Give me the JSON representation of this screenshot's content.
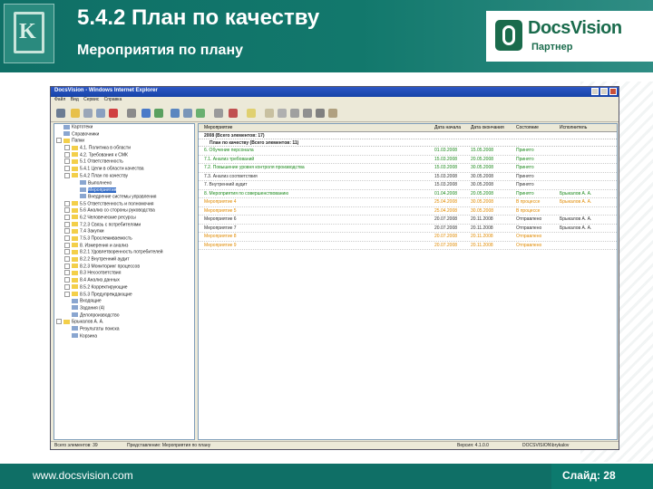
{
  "slide": {
    "title": "5.4.2 План по качеству",
    "subtitle": "Мероприятия по плану",
    "footer_url": "www.docsvision.com",
    "slide_number": "Слайд: 28"
  },
  "brand": {
    "name": "DocsVision",
    "partner": "Партнер",
    "colors": {
      "header": "#0f6f66",
      "logo_green": "#1a6b4c",
      "link_green": "#1d8a1d",
      "orange": "#e08a00"
    }
  },
  "window": {
    "title": "DocsVision - Windows Internet Explorer",
    "menu": [
      "Файл",
      "Вид",
      "Сервис",
      "Справка"
    ],
    "tree": [
      {
        "label": "Картотеки",
        "depth": 0,
        "type": "leaf",
        "icon": "doc"
      },
      {
        "label": "Справочники",
        "depth": 0,
        "type": "leaf",
        "icon": "doc"
      },
      {
        "label": "Папки",
        "depth": 0,
        "type": "collapse",
        "icon": "folder"
      },
      {
        "label": "4.1. Политика в области",
        "depth": 1,
        "type": "expand",
        "icon": "folder"
      },
      {
        "label": "4.2. Требования к СМК",
        "depth": 1,
        "type": "expand",
        "icon": "folder"
      },
      {
        "label": "5.1 Ответственность",
        "depth": 1,
        "type": "expand",
        "icon": "folder"
      },
      {
        "label": "5.4.1 Цели в области качества",
        "depth": 1,
        "type": "expand",
        "icon": "folder"
      },
      {
        "label": "5.4.2 План по качеству",
        "depth": 1,
        "type": "collapse",
        "icon": "folder"
      },
      {
        "label": "Выполнено",
        "depth": 2,
        "type": "leaf",
        "icon": "doc"
      },
      {
        "label": "Мероприятия",
        "depth": 2,
        "type": "leaf",
        "icon": "doc",
        "selected": true
      },
      {
        "label": "Внедрение системы управления",
        "depth": 2,
        "type": "leaf",
        "icon": "doc"
      },
      {
        "label": "5.5 Ответственность и полномочия",
        "depth": 1,
        "type": "expand",
        "icon": "folder"
      },
      {
        "label": "5.6 Анализ со стороны руководства",
        "depth": 1,
        "type": "expand",
        "icon": "folder"
      },
      {
        "label": "6.2 Человеческие ресурсы",
        "depth": 1,
        "type": "expand",
        "icon": "folder"
      },
      {
        "label": "7.2.3 Связь с потребителями",
        "depth": 1,
        "type": "expand",
        "icon": "folder"
      },
      {
        "label": "7.4 Закупки",
        "depth": 1,
        "type": "expand",
        "icon": "folder"
      },
      {
        "label": "7.5.3 Прослеживаемость",
        "depth": 1,
        "type": "expand",
        "icon": "folder"
      },
      {
        "label": "8. Измерения и анализ",
        "depth": 1,
        "type": "expand",
        "icon": "folder"
      },
      {
        "label": "8.2.1 Удовлетворенность потребителей",
        "depth": 1,
        "type": "expand",
        "icon": "folder"
      },
      {
        "label": "8.2.2 Внутренний аудит",
        "depth": 1,
        "type": "expand",
        "icon": "folder"
      },
      {
        "label": "8.2.3 Мониторинг процессов",
        "depth": 1,
        "type": "expand",
        "icon": "folder"
      },
      {
        "label": "8.3 Несоответствия",
        "depth": 1,
        "type": "expand",
        "icon": "folder"
      },
      {
        "label": "8.4 Анализ данных",
        "depth": 1,
        "type": "expand",
        "icon": "folder"
      },
      {
        "label": "8.5.2 Корректирующие",
        "depth": 1,
        "type": "expand",
        "icon": "folder"
      },
      {
        "label": "8.5.3 Предупреждающие",
        "depth": 1,
        "type": "expand",
        "icon": "folder"
      },
      {
        "label": "Входящие",
        "depth": 1,
        "type": "leaf",
        "icon": "doc"
      },
      {
        "label": "Задания (4)",
        "depth": 1,
        "type": "leaf",
        "icon": "doc"
      },
      {
        "label": "Делопроизводство",
        "depth": 1,
        "type": "leaf",
        "icon": "doc"
      },
      {
        "label": "Брыкалов А. А.",
        "depth": 0,
        "type": "collapse",
        "icon": "folder"
      },
      {
        "label": "Результаты поиска",
        "depth": 1,
        "type": "leaf",
        "icon": "doc"
      },
      {
        "label": "Корзина",
        "depth": 1,
        "type": "leaf",
        "icon": "doc"
      }
    ],
    "columns": [
      "Мероприятие",
      "Дата начала",
      "Дата окончания",
      "Состояние",
      "Исполнитель"
    ],
    "group1": "2008 (Всего элементов: 17)",
    "group2": "План по качеству (Всего элементов: 11)",
    "rows": [
      {
        "name": "6. Обучение персонала",
        "start": "01.03.2008",
        "end": "15.05.2008",
        "status": "Принято",
        "owner": "",
        "color": "green"
      },
      {
        "name": "7.1. Анализ требований",
        "start": "15.03.2008",
        "end": "20.05.2008",
        "status": "Принято",
        "owner": "",
        "color": "green"
      },
      {
        "name": "7.2. Повышение уровня контроля производства",
        "start": "15.03.2008",
        "end": "30.05.2008",
        "status": "Принято",
        "owner": "",
        "color": "green"
      },
      {
        "name": "7.3. Анализ соответствия",
        "start": "15.03.2008",
        "end": "30.05.2008",
        "status": "Принято",
        "owner": "",
        "color": "dark"
      },
      {
        "name": "7. Внутренний аудит",
        "start": "15.03.2008",
        "end": "30.05.2008",
        "status": "Принято",
        "owner": "",
        "color": "dark"
      },
      {
        "name": "8. Мероприятия по совершенствованию",
        "start": "01.04.2008",
        "end": "20.05.2008",
        "status": "Принято",
        "owner": "Брыкалов А. А.",
        "color": "green"
      },
      {
        "name": "Мероприятие 4",
        "start": "25.04.2008",
        "end": "30.05.2008",
        "status": "В процессе",
        "owner": "Брыкалов А. А.",
        "color": "orange"
      },
      {
        "name": "Мероприятие 5",
        "start": "25.04.2008",
        "end": "30.05.2008",
        "status": "В процессе",
        "owner": "",
        "color": "orange"
      },
      {
        "name": "Мероприятие 6",
        "start": "20.07.2008",
        "end": "20.11.2008",
        "status": "Отправлено",
        "owner": "Брыкалов А. А.",
        "color": "dark"
      },
      {
        "name": "Мероприятие 7",
        "start": "20.07.2008",
        "end": "20.11.2008",
        "status": "Отправлено",
        "owner": "Брыкалов А. А.",
        "color": "dark"
      },
      {
        "name": "Мероприятие 8",
        "start": "20.07.2008",
        "end": "20.11.2008",
        "status": "Отправлено",
        "owner": "",
        "color": "orange"
      },
      {
        "name": "Мероприятие 9",
        "start": "20.07.2008",
        "end": "20.11.2008",
        "status": "Отправлено",
        "owner": "",
        "color": "orange"
      }
    ],
    "status_bar": {
      "items_count": "Всего элементов: 39",
      "view": "Представление: Мероприятия по плану",
      "version": "Версия: 4.1.0.0",
      "user": "DOCSVISION\\brykalov"
    }
  }
}
